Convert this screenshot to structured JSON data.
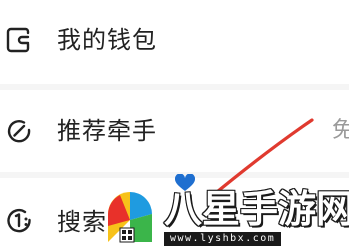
{
  "menu": {
    "items": [
      {
        "label": "我的钱包",
        "icon": "wallet-icon"
      },
      {
        "label": "推荐牵手",
        "icon": "recommend-icon",
        "trailing": "免"
      },
      {
        "label": "搜索",
        "icon": "search-icon"
      }
    ]
  },
  "watermark": {
    "text": "八星手游网",
    "url": "www.lyshbx.com",
    "colors": {
      "red": "#e8312a",
      "yellow": "#f7c21a",
      "blue": "#1f9be0",
      "green": "#3bb54a"
    }
  },
  "annotation": {
    "arrow_color": "#e03a2f"
  },
  "colors": {
    "text": "#222222",
    "secondary": "#9a9a9a",
    "divider": "#f5f5f5"
  }
}
